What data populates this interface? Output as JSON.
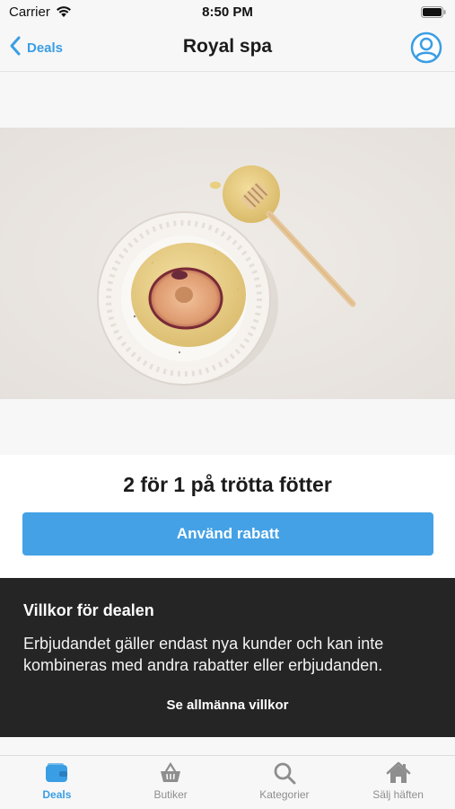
{
  "status_bar": {
    "carrier": "Carrier",
    "time": "8:50 PM"
  },
  "nav": {
    "back_label": "Deals",
    "title": "Royal spa"
  },
  "hero": {
    "image": "plum-on-plate-with-honey-dipper"
  },
  "deal": {
    "title": "2 för 1 på trötta fötter",
    "button_label": "Använd rabatt"
  },
  "terms": {
    "heading": "Villkor för dealen",
    "body": "Erbjudandet gäller endast nya kunder och kan inte kombineras med andra rabatter eller erbjudanden.",
    "link_label": "Se allmänna villkor"
  },
  "tabs": [
    {
      "label": "Deals",
      "icon": "wallet-icon",
      "active": true
    },
    {
      "label": "Butiker",
      "icon": "basket-icon",
      "active": false
    },
    {
      "label": "Kategorier",
      "icon": "search-icon",
      "active": false
    },
    {
      "label": "Sälj häften",
      "icon": "house-icon",
      "active": false
    }
  ],
  "colors": {
    "accent": "#3a9ee4",
    "button": "#44a1e5",
    "terms_background": "#252525",
    "inactive_tab": "#8e8e8e"
  }
}
